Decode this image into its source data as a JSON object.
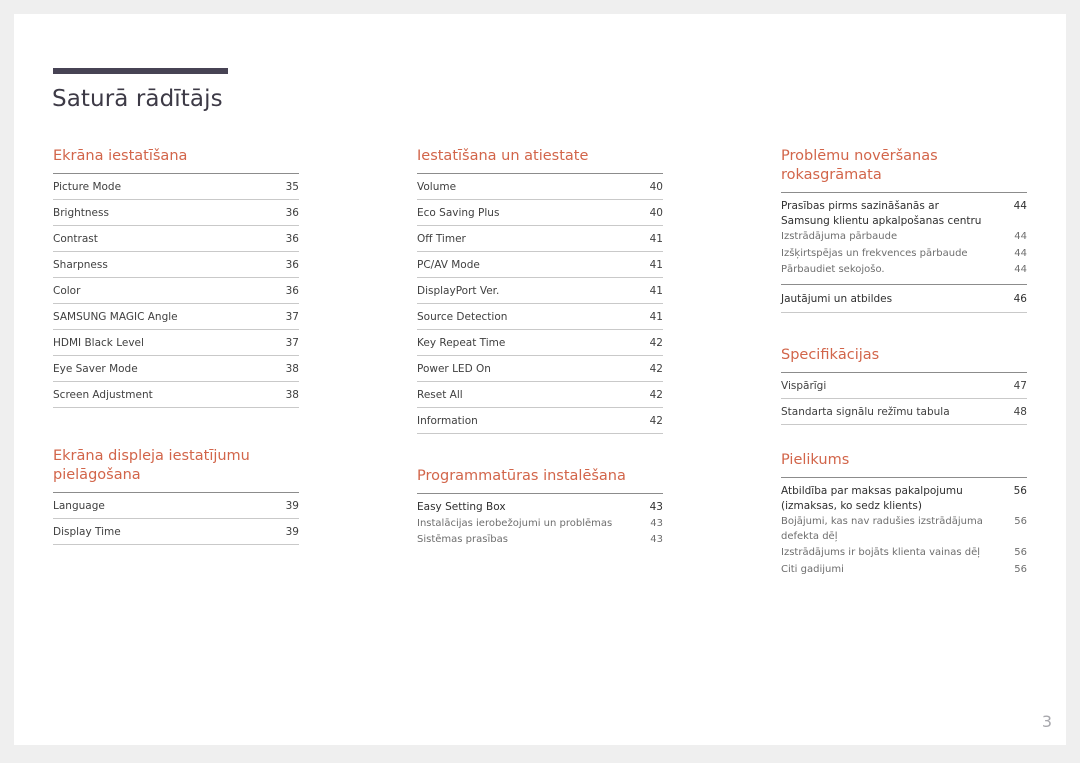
{
  "document": {
    "title": "Saturā rādītājs",
    "page_number": "3",
    "accent_color": "#d2654a",
    "rule_color": "#474354"
  },
  "columns": [
    {
      "name": "column-1",
      "sections": [
        {
          "heading": "Ekrāna iestatīšana",
          "rows": [
            {
              "label": "Picture Mode",
              "page": "35"
            },
            {
              "label": "Brightness",
              "page": "36"
            },
            {
              "label": "Contrast",
              "page": "36"
            },
            {
              "label": "Sharpness",
              "page": "36"
            },
            {
              "label": "Color",
              "page": "36"
            },
            {
              "label": "SAMSUNG MAGIC Angle",
              "page": "37"
            },
            {
              "label": "HDMI Black Level",
              "page": "37"
            },
            {
              "label": "Eye Saver Mode",
              "page": "38"
            },
            {
              "label": "Screen Adjustment",
              "page": "38"
            }
          ]
        },
        {
          "heading": "Ekrāna displeja iestatījumu pielāgošana",
          "rows": [
            {
              "label": "Language",
              "page": "39"
            },
            {
              "label": "Display Time",
              "page": "39"
            }
          ]
        }
      ]
    },
    {
      "name": "column-2",
      "sections": [
        {
          "heading": "Iestatīšana un atiestate",
          "rows": [
            {
              "label": "Volume",
              "page": "40"
            },
            {
              "label": "Eco Saving Plus",
              "page": "40"
            },
            {
              "label": "Off Timer",
              "page": "41"
            },
            {
              "label": "PC/AV Mode",
              "page": "41"
            },
            {
              "label": "DisplayPort Ver.",
              "page": "41"
            },
            {
              "label": "Source Detection",
              "page": "41"
            },
            {
              "label": "Key Repeat Time",
              "page": "42"
            },
            {
              "label": "Power LED On",
              "page": "42"
            },
            {
              "label": "Reset All",
              "page": "42"
            },
            {
              "label": "Information",
              "page": "42"
            }
          ]
        },
        {
          "heading": "Programmatūras instalēšana",
          "group": {
            "lead": {
              "label": "Easy Setting Box",
              "page": "43"
            },
            "subs": [
              {
                "label": "Instalācijas ierobežojumi un problēmas",
                "page": "43"
              },
              {
                "label": "Sistēmas prasības",
                "page": "43"
              }
            ]
          }
        }
      ]
    },
    {
      "name": "column-3",
      "sections": [
        {
          "heading": "Problēmu novēršanas rokasgrāmata",
          "group": {
            "lead": {
              "label": "Prasības pirms sazināšanās ar Samsung klientu apkalpošanas centru",
              "page": "44"
            },
            "subs": [
              {
                "label": "Izstrādājuma pārbaude",
                "page": "44"
              },
              {
                "label": "Izšķirtspējas un frekvences pārbaude",
                "page": "44"
              },
              {
                "label": "Pārbaudiet sekojošo.",
                "page": "44"
              }
            ]
          },
          "tail_rows": [
            {
              "label": "Jautājumi un atbildes",
              "page": "46"
            }
          ]
        },
        {
          "heading": "Specifikācijas",
          "rows": [
            {
              "label": "Vispārīgi",
              "page": "47"
            },
            {
              "label": "Standarta signālu režīmu tabula",
              "page": "48"
            }
          ]
        },
        {
          "heading": "Pielikums",
          "group": {
            "lead": {
              "label": "Atbildība par maksas pakalpojumu (izmaksas, ko sedz klients)",
              "page": "56"
            },
            "subs": [
              {
                "label": "Bojājumi, kas nav radušies izstrādājuma defekta dēļ",
                "page": "56"
              },
              {
                "label": "Izstrādājums ir bojāts klienta vainas dēļ",
                "page": "56"
              },
              {
                "label": "Citi gadijumi",
                "page": "56"
              }
            ]
          }
        }
      ]
    }
  ]
}
